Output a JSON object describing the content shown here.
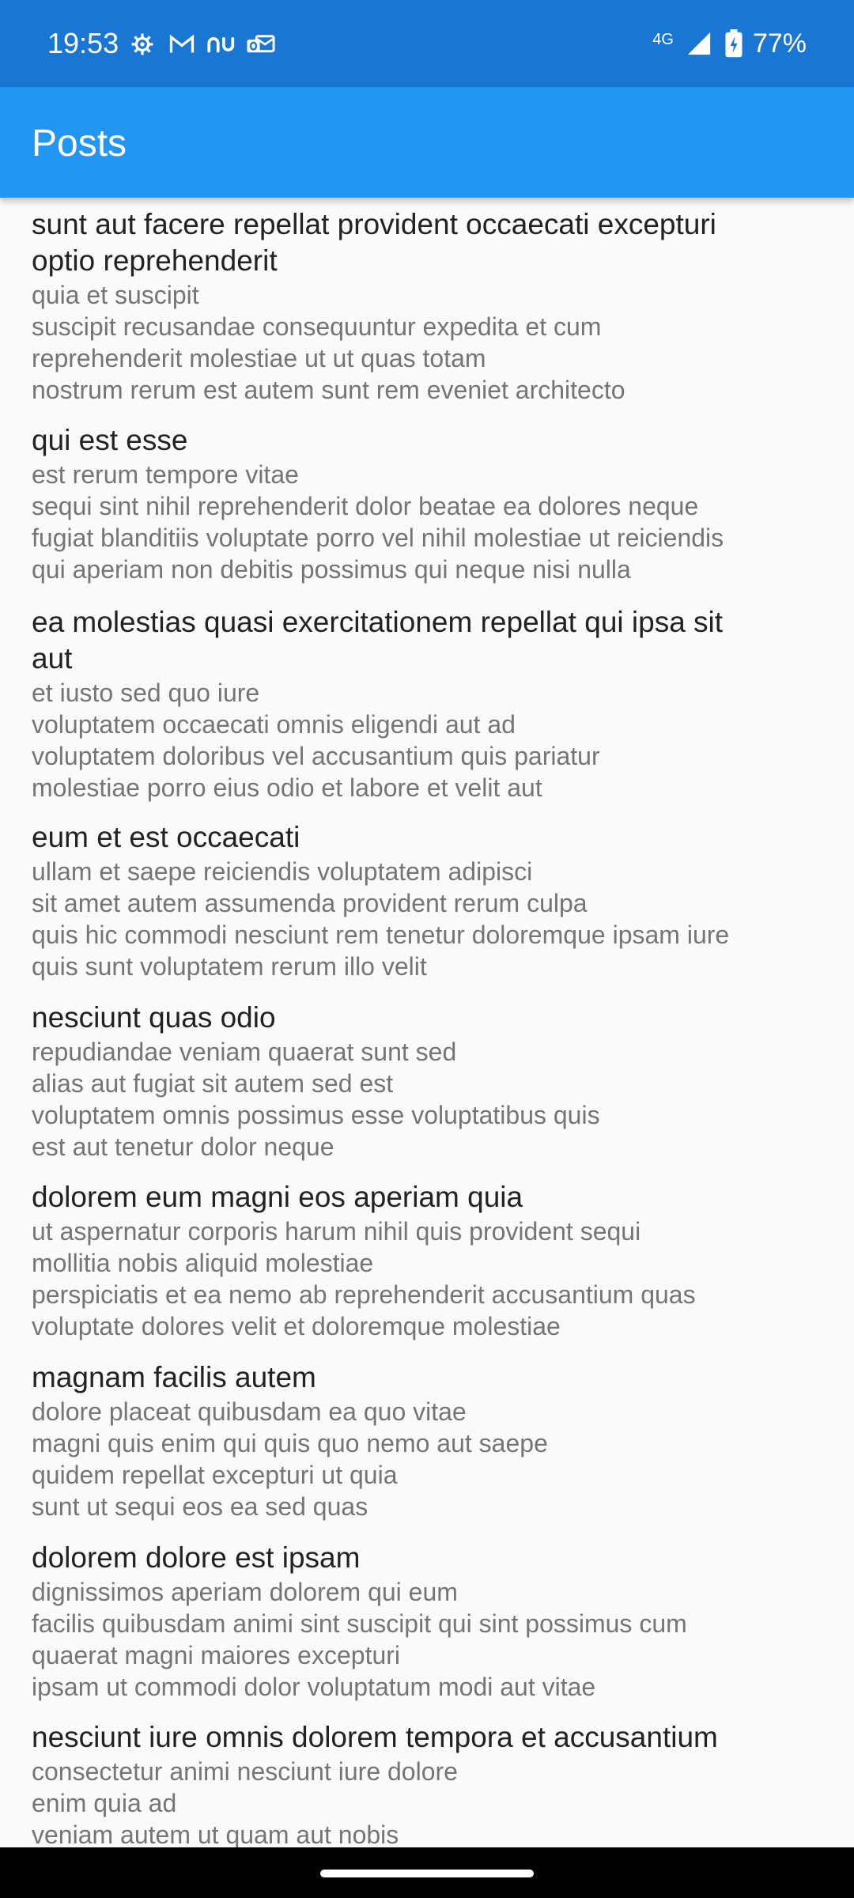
{
  "status_bar": {
    "time": "19:53",
    "network": "4G",
    "battery": "77%",
    "icons": [
      "settings-icon",
      "gmail-icon",
      "nu-app-icon",
      "outlook-icon",
      "network-4g-icon",
      "signal-icon",
      "battery-charging-icon"
    ]
  },
  "app_bar": {
    "title": "Posts"
  },
  "posts": [
    {
      "title_lines": [
        "sunt aut facere repellat provident occaecati excepturi",
        "optio reprehenderit"
      ],
      "body_lines": [
        "quia et suscipit",
        "suscipit recusandae consequuntur expedita et cum",
        "reprehenderit molestiae ut ut quas totam",
        "nostrum rerum est autem sunt rem eveniet architecto"
      ]
    },
    {
      "title_lines": [
        "qui est esse"
      ],
      "body_lines": [
        "est rerum tempore vitae",
        "sequi sint nihil reprehenderit dolor beatae ea dolores neque",
        "fugiat blanditiis voluptate porro vel nihil molestiae ut reiciendis",
        "qui aperiam non debitis possimus qui neque nisi nulla"
      ]
    },
    {
      "title_lines": [
        "ea molestias quasi exercitationem repellat qui ipsa sit",
        "aut"
      ],
      "body_lines": [
        "et iusto sed quo iure",
        "voluptatem occaecati omnis eligendi aut ad",
        "voluptatem doloribus vel accusantium quis pariatur",
        "molestiae porro eius odio et labore et velit aut"
      ]
    },
    {
      "title_lines": [
        "eum et est occaecati"
      ],
      "body_lines": [
        "ullam et saepe reiciendis voluptatem adipisci",
        "sit amet autem assumenda provident rerum culpa",
        "quis hic commodi nesciunt rem tenetur doloremque ipsam iure",
        "quis sunt voluptatem rerum illo velit"
      ]
    },
    {
      "title_lines": [
        "nesciunt quas odio"
      ],
      "body_lines": [
        "repudiandae veniam quaerat sunt sed",
        "alias aut fugiat sit autem sed est",
        "voluptatem omnis possimus esse voluptatibus quis",
        "est aut tenetur dolor neque"
      ]
    },
    {
      "title_lines": [
        "dolorem eum magni eos aperiam quia"
      ],
      "body_lines": [
        "ut aspernatur corporis harum nihil quis provident sequi",
        "mollitia nobis aliquid molestiae",
        "perspiciatis et ea nemo ab reprehenderit accusantium quas",
        "voluptate dolores velit et doloremque molestiae"
      ]
    },
    {
      "title_lines": [
        "magnam facilis autem"
      ],
      "body_lines": [
        "dolore placeat quibusdam ea quo vitae",
        "magni quis enim qui quis quo nemo aut saepe",
        "quidem repellat excepturi ut quia",
        "sunt ut sequi eos ea sed quas"
      ]
    },
    {
      "title_lines": [
        "dolorem dolore est ipsam"
      ],
      "body_lines": [
        "dignissimos aperiam dolorem qui eum",
        "facilis quibusdam animi sint suscipit qui sint possimus cum",
        "quaerat magni maiores excepturi",
        "ipsam ut commodi dolor voluptatum modi aut vitae"
      ]
    },
    {
      "title_lines": [
        "nesciunt iure omnis dolorem tempora et accusantium"
      ],
      "body_lines": [
        "consectetur animi nesciunt iure dolore",
        "enim quia ad",
        "veniam autem ut quam aut nobis"
      ]
    }
  ]
}
